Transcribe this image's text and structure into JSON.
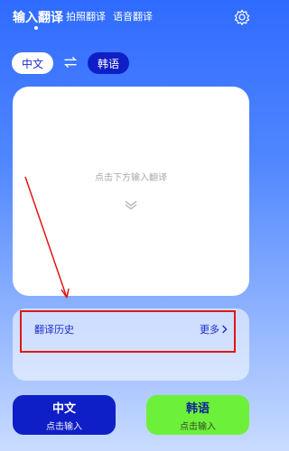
{
  "tabs": [
    {
      "label": "输入翻译",
      "active": true
    },
    {
      "label": "拍照翻译",
      "active": false
    },
    {
      "label": "语音翻译",
      "active": false
    }
  ],
  "icons": {
    "settings": "gear-icon",
    "swap": "swap-icon",
    "chevron": "double-chevron-down-icon",
    "more": "chevron-right-icon"
  },
  "languages": {
    "source": "中文",
    "target": "韩语"
  },
  "input_area": {
    "placeholder": "点击下方输入翻译"
  },
  "history": {
    "title": "翻译历史",
    "more": "更多"
  },
  "buttons": {
    "left": {
      "title": "中文",
      "subtitle": "点击输入"
    },
    "right": {
      "title": "韩语",
      "subtitle": "点击输入"
    }
  },
  "colors": {
    "primary": "#0f1fc7",
    "accent_green": "#6df03a",
    "annotation_red": "#e01616"
  }
}
